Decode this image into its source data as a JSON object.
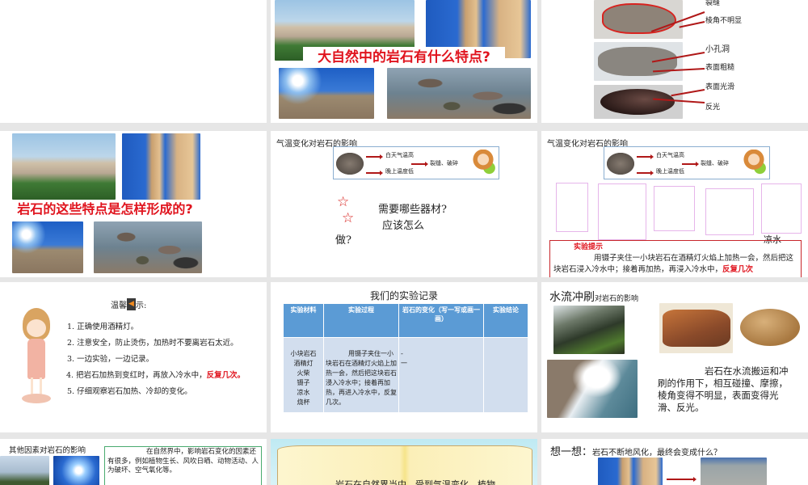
{
  "slides": {
    "s2": {
      "banner": "大自然中的岩石有什么特点?"
    },
    "s3": {
      "labels": [
        "裂缝",
        "棱角不明显",
        "小孔洞",
        "表面粗糙",
        "表面光滑",
        "反光"
      ]
    },
    "s4": {
      "banner": "岩石的这些特点是怎样形成的?"
    },
    "s5": {
      "title": "气温变化对岩石的影响",
      "day": "白天气温高",
      "night": "晚上温度低",
      "result": "裂缝、破碎",
      "q1": "需要哪些器材?",
      "q2": "应该怎么",
      "q3": "做?"
    },
    "s6": {
      "title": "气温变化对岩石的影响",
      "day": "白天气温高",
      "night": "晚上温度低",
      "result": "裂缝、破碎",
      "cold_water": "凉水",
      "tip_title": "实验提示",
      "tip_text": "用镊子夹住一小块岩石在酒精灯火焰上加热一会，然后把这块岩石浸入冷水中；接着再加热，再浸入冷水中，",
      "tip_red": "反复几次"
    },
    "s7": {
      "title_a": "温馨",
      "title_b": "示:",
      "items": [
        "1. 正确使用酒精灯。",
        "2. 注意安全，防止烫伤，加热时不要离岩石太近。",
        "3. 一边实验，一边记录。",
        "4. 把岩石加热到变红时，再放入冷水中，",
        "5. 仔细观察岩石加热、冷却的变化。"
      ],
      "item4_red": "反复几次。"
    },
    "s8": {
      "title": "我们的实验记录",
      "headers": [
        "实验材料",
        "实验过程",
        "岩石的变化（写一写或画一画）",
        "实验结论"
      ],
      "materials": [
        "小块岩石",
        "酒精灯",
        "火柴",
        "镊子",
        "凉水",
        "烧杯"
      ],
      "process": "用镊子夹住一小块岩石在酒精灯火焰上加热一会，然后把这块岩石浸入冷水中；接着再加热，再进入冷水中，反复几次。",
      "change": "-\n一",
      "conclusion": ""
    },
    "s9": {
      "title_big": "水流冲刷",
      "title_small": "对岩石的影响",
      "text": "岩石在水流搬运和冲刷的作用下，相互碰撞、摩擦，棱角变得不明显，表面变得光滑、反光。"
    },
    "s10": {
      "title": "其他因素对岩石的影响",
      "text": "在自然界中，影响岩石变化的因素还有很多，例如植物生长、风吹日晒、动物活动、人为破坏、空气氧化等。"
    },
    "s11": {
      "text": "岩石在自然界当中，受到气温变化、植物"
    },
    "s12": {
      "label": "想一想：",
      "question": "岩石不断地风化，最终会变成什么？"
    }
  },
  "colors": {
    "accent_red": "#e0141e",
    "table_header": "#5b9bd5",
    "table_body": "#d2deee",
    "background": "#e6e6e6"
  }
}
